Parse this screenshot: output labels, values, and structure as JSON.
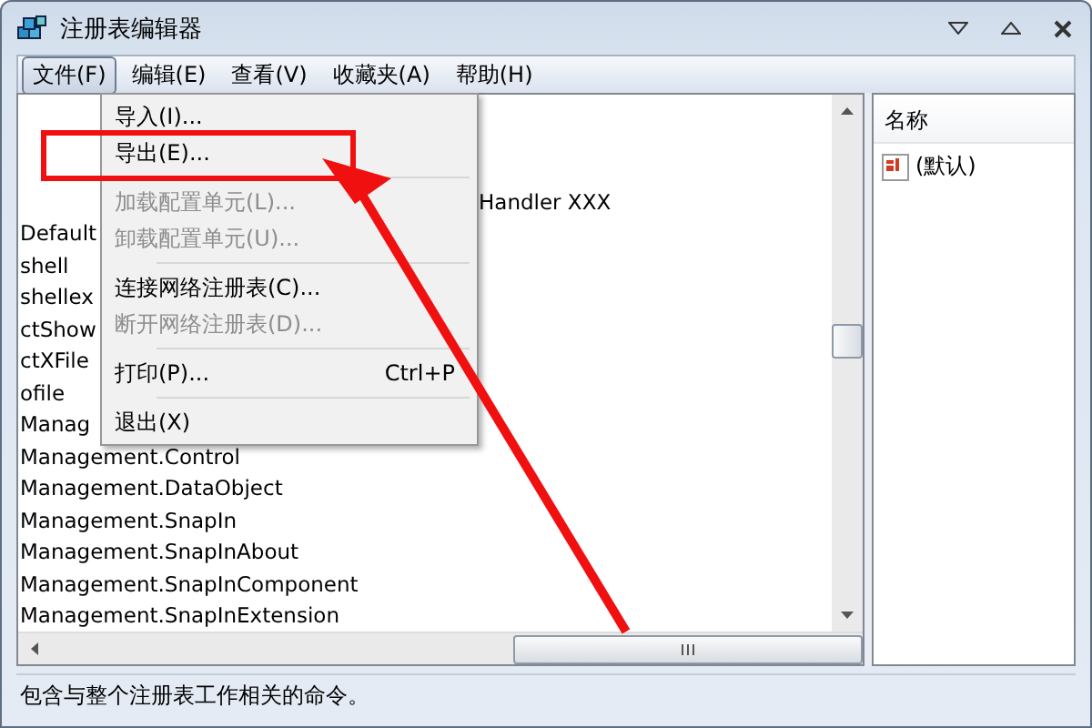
{
  "window": {
    "title": "注册表编辑器"
  },
  "menu_bar": [
    {
      "label": "文件(F)",
      "selected": true
    },
    {
      "label": "编辑(E)",
      "selected": false
    },
    {
      "label": "查看(V)",
      "selected": false
    },
    {
      "label": "收藏夹(A)",
      "selected": false
    },
    {
      "label": "帮助(H)",
      "selected": false
    }
  ],
  "file_menu": [
    {
      "kind": "item",
      "label": "导入(I)...",
      "disabled": false
    },
    {
      "kind": "item",
      "label": "导出(E)...",
      "disabled": false
    },
    {
      "kind": "separator"
    },
    {
      "kind": "item",
      "label": "加载配置单元(L)...",
      "disabled": true
    },
    {
      "kind": "item",
      "label": "卸载配置单元(U)...",
      "disabled": true
    },
    {
      "kind": "separator"
    },
    {
      "kind": "item",
      "label": "连接网络注册表(C)...",
      "disabled": false
    },
    {
      "kind": "item",
      "label": "断开网络注册表(D)...",
      "disabled": true
    },
    {
      "kind": "separator"
    },
    {
      "kind": "item",
      "label": "打印(P)...",
      "shortcut": "Ctrl+P",
      "disabled": false
    },
    {
      "kind": "separator"
    },
    {
      "kind": "item",
      "label": "退出(X)",
      "disabled": false
    }
  ],
  "tree": [
    {
      "text": "Handler XXX",
      "kind": "right"
    },
    {
      "text": "Default",
      "kind": "left"
    },
    {
      "text": "shell",
      "kind": "left"
    },
    {
      "text": "shellex",
      "kind": "left"
    },
    {
      "text": "ctShow",
      "kind": "left"
    },
    {
      "text": "ctXFile",
      "kind": "left"
    },
    {
      "text": "ofile",
      "kind": "left"
    },
    {
      "text": "Manag",
      "kind": "left"
    },
    {
      "text": "Management.Control",
      "kind": "full"
    },
    {
      "text": "Management.DataObject",
      "kind": "full"
    },
    {
      "text": "Management.SnapIn",
      "kind": "full"
    },
    {
      "text": "Management.SnapInAbout",
      "kind": "full"
    },
    {
      "text": "Management.SnapInComponent",
      "kind": "full"
    },
    {
      "text": "Management.SnapInExtension",
      "kind": "full"
    }
  ],
  "values": {
    "columns": [
      "名称"
    ],
    "rows": [
      {
        "name": "(默认)"
      }
    ]
  },
  "status_bar": "包含与整个注册表工作相关的命令。"
}
